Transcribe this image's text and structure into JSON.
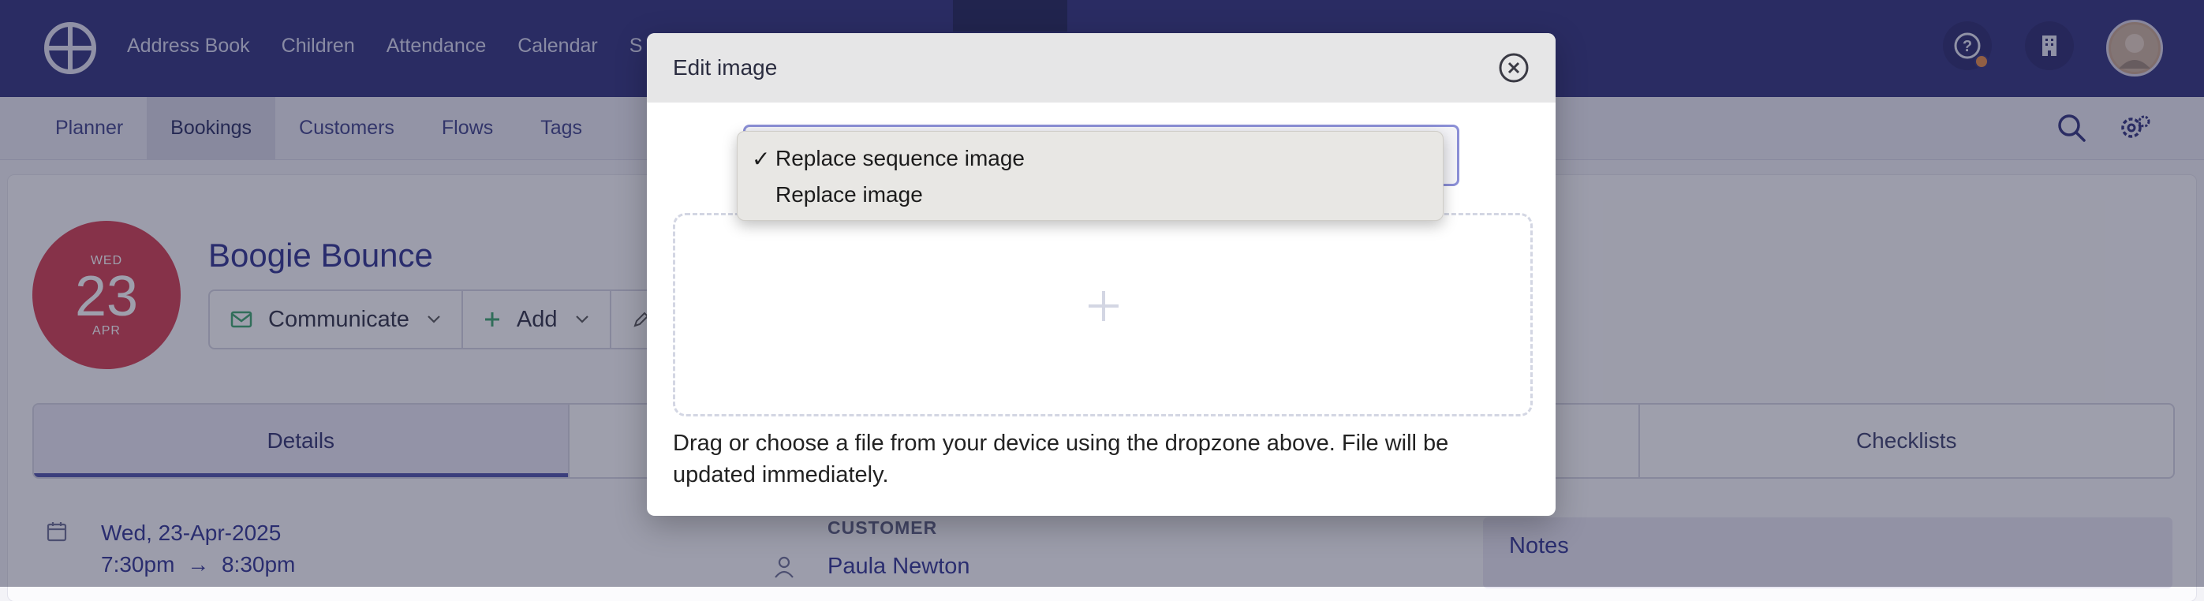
{
  "topnav": {
    "items": [
      "Address Book",
      "Children",
      "Attendance",
      "Calendar",
      "S"
    ]
  },
  "subnav": {
    "items": [
      "Planner",
      "Bookings",
      "Customers",
      "Flows",
      "Tags"
    ],
    "active": "Bookings"
  },
  "event": {
    "dow": "WED",
    "day": "23",
    "month": "APR",
    "title": "Boogie Bounce",
    "actions": [
      "Communicate",
      "Add"
    ]
  },
  "tabs": [
    "Details",
    "",
    "",
    "Checklists"
  ],
  "details": {
    "date": "Wed, 23-Apr-2025",
    "time_start": "7:30pm",
    "time_arrow": "→",
    "time_end": "8:30pm",
    "customer_label": "CUSTOMER",
    "customer_name": "Paula Newton",
    "notes_label": "Notes"
  },
  "modal": {
    "title": "Edit image",
    "help_text": "Drag or choose a file from your device using the dropzone above. File will be updated immediately."
  },
  "dropdown": {
    "options": [
      {
        "label": "Replace sequence image",
        "selected": true,
        "check": "✓"
      },
      {
        "label": "Replace image",
        "selected": false,
        "check": ""
      }
    ]
  },
  "colors": {
    "nav_bg": "#2d2e7a",
    "accent": "#4b4fa8",
    "date_badge": "#d33a4c",
    "select_focus": "#8b8fd6"
  }
}
